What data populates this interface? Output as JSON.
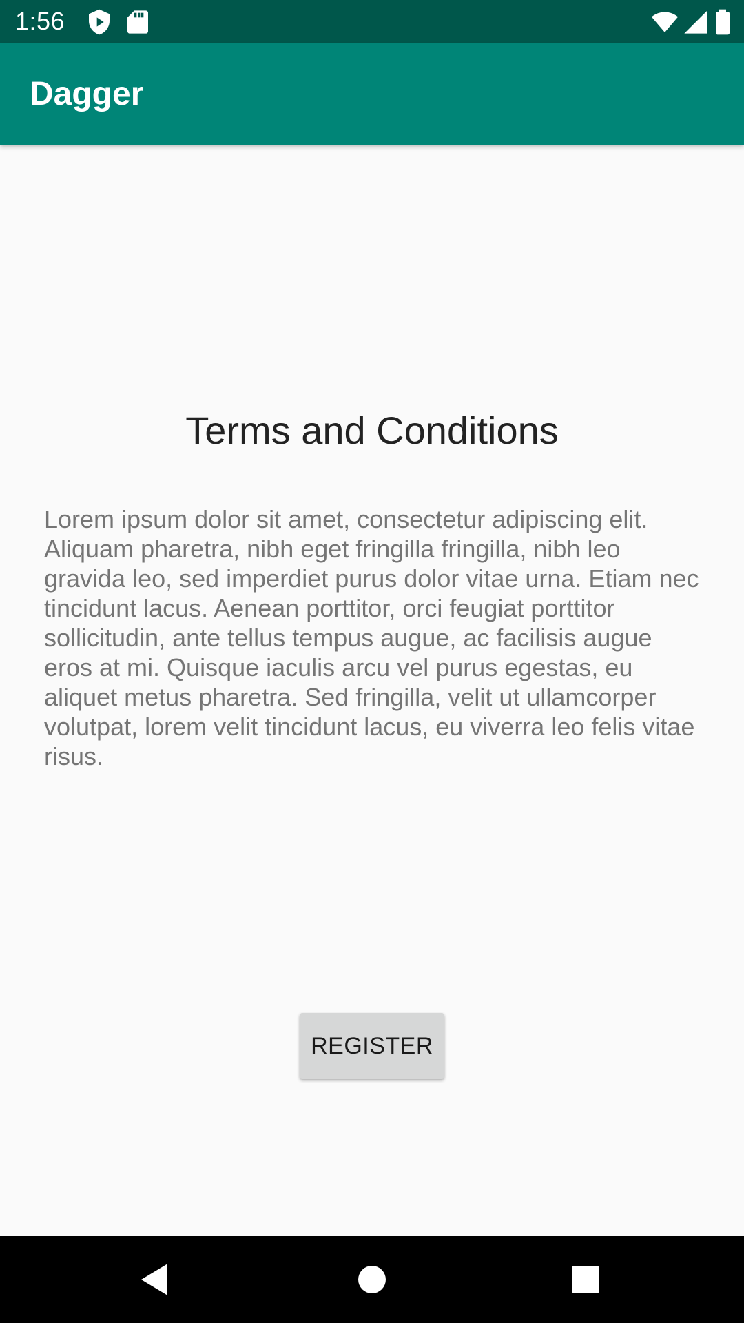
{
  "status_bar": {
    "time": "1:56",
    "icons": [
      "shield-icon",
      "sd-card-icon",
      "wifi-icon",
      "signal-icon",
      "battery-icon"
    ]
  },
  "app_bar": {
    "title": "Dagger",
    "color": "#008577"
  },
  "content": {
    "title": "Terms and Conditions",
    "body": "Lorem ipsum dolor sit amet, consectetur adipiscing elit. Aliquam pharetra, nibh eget fringilla fringilla, nibh leo gravida leo, sed imperdiet purus dolor vitae urna. Etiam nec tincidunt lacus. Aenean porttitor, orci feugiat porttitor sollicitudin, ante tellus tempus augue, ac facilisis augue eros at mi. Quisque iaculis arcu vel purus egestas, eu aliquet metus pharetra. Sed fringilla, velit ut ullamcorper volutpat, lorem velit tincidunt lacus, eu viverra leo felis vitae risus.",
    "button_label": "REGISTER"
  },
  "nav_bar": {
    "icons": [
      "back-icon",
      "home-icon",
      "recents-icon"
    ]
  }
}
